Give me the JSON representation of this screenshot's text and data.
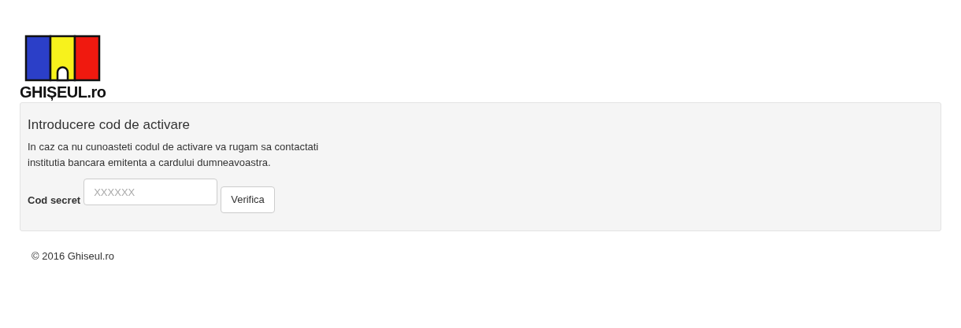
{
  "logo": {
    "text": "GHIȘEUL.ro"
  },
  "panel": {
    "title": "Introducere cod de activare",
    "description": "In caz ca nu cunoasteti codul de activare va rugam sa contactati institutia bancara emitenta a cardului dumneavoastra.",
    "field": {
      "label": "Cod secret",
      "placeholder": "XXXXXX"
    },
    "button": "Verifica"
  },
  "footer": "© 2016 Ghiseul.ro"
}
